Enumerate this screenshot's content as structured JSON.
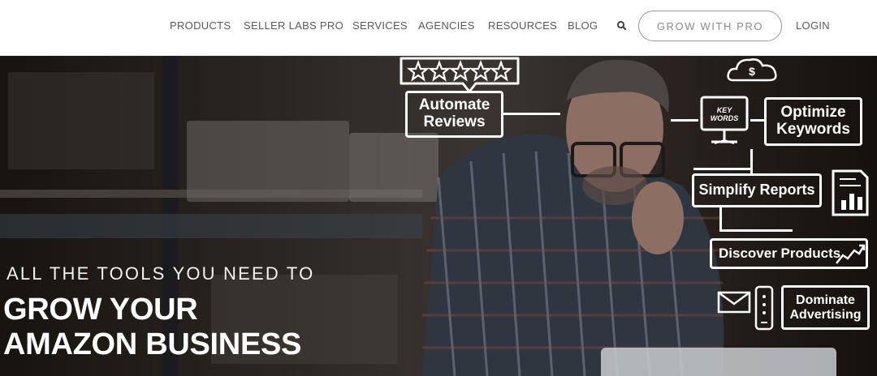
{
  "nav": {
    "links": [
      {
        "label": "PRODUCTS"
      },
      {
        "label": "SELLER LABS PRO"
      },
      {
        "label": "SERVICES"
      },
      {
        "label": "AGENCIES"
      },
      {
        "label": "RESOURCES"
      },
      {
        "label": "BLOG"
      }
    ],
    "search_icon": "search-icon",
    "cta_label": "GROW WITH PRO",
    "login_label": "LOGIN"
  },
  "hero": {
    "tagline": "ALL THE TOOLS YOU NEED TO",
    "title_line1": "GROW YOUR",
    "title_line2": "AMAZON BUSINESS",
    "illustration": {
      "automate_reviews": "Automate Reviews",
      "optimize_keywords": "Optimize Keywords",
      "key_words": "KEY WORDS",
      "simplify_reports": "Simplify Reports",
      "discover_products": "Discover Products",
      "dominate_advertising": "Dominate Advertising"
    }
  },
  "colors": {
    "nav_text": "#5a5a5a",
    "cta_border": "#9a9a9a",
    "hero_text": "#ffffff"
  }
}
